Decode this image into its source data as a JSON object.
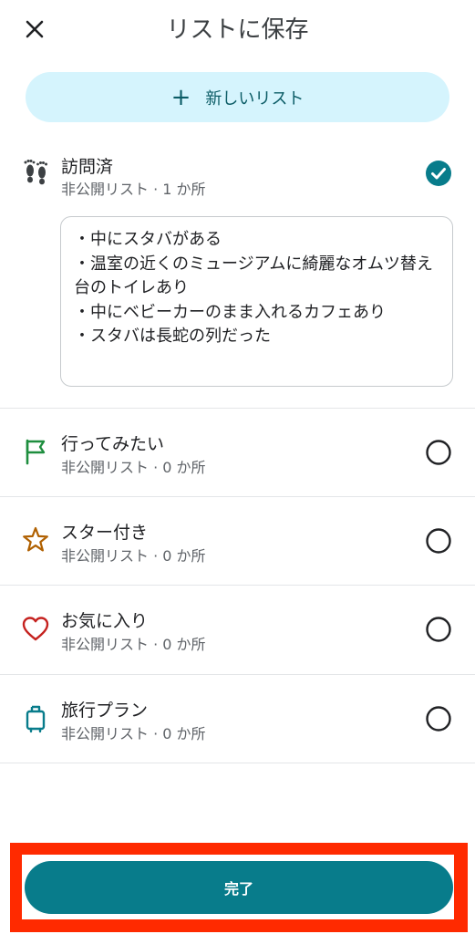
{
  "header": {
    "title": "リストに保存"
  },
  "new_list": {
    "label": "新しいリスト"
  },
  "lists": [
    {
      "name": "訪問済",
      "meta": "非公開リスト · 1 か所",
      "icon": "footprints-icon",
      "color": "#3c4043",
      "selected": true
    },
    {
      "name": "行ってみたい",
      "meta": "非公開リスト · 0 か所",
      "icon": "flag-icon",
      "color": "#1e8e3e",
      "selected": false
    },
    {
      "name": "スター付き",
      "meta": "非公開リスト · 0 か所",
      "icon": "star-icon",
      "color": "#b06000",
      "selected": false
    },
    {
      "name": "お気に入り",
      "meta": "非公開リスト · 0 か所",
      "icon": "heart-icon",
      "color": "#c5221f",
      "selected": false
    },
    {
      "name": "旅行プラン",
      "meta": "非公開リスト · 0 か所",
      "icon": "suitcase-icon",
      "color": "#087c8b",
      "selected": false
    }
  ],
  "note": {
    "text": "・中にスタバがある\n・温室の近くのミュージアムに綺麗なオムツ替え台のトイレあり\n・中にベビーカーのまま入れるカフェあり\n・スタバは長蛇の列だった"
  },
  "footer": {
    "done_label": "完了"
  },
  "colors": {
    "accent": "#087c8b",
    "new_list_bg": "#d5f4fd",
    "highlight": "#ff2a00"
  }
}
